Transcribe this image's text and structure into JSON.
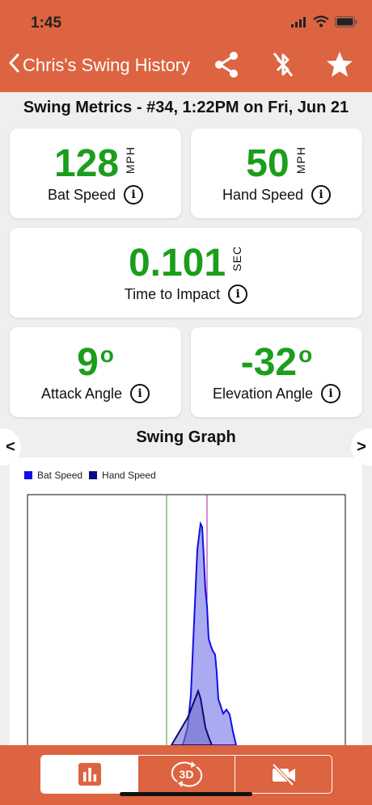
{
  "status": {
    "time": "1:45"
  },
  "nav": {
    "back_label": "Chris's Swing History"
  },
  "metrics_title": "Swing Metrics - #34, 1:22PM on Fri, Jun 21",
  "metrics": {
    "bat_speed": {
      "value": "128",
      "unit": "MPH",
      "label": "Bat Speed"
    },
    "hand_speed": {
      "value": "50",
      "unit": "MPH",
      "label": "Hand Speed"
    },
    "time_to_impact": {
      "value": "0.101",
      "unit": "SEC",
      "label": "Time to Impact"
    },
    "attack_angle": {
      "value": "9",
      "unit": "o",
      "label": "Attack Angle"
    },
    "elevation_angle": {
      "value": "-32",
      "unit": "o",
      "label": "Elevation Angle"
    }
  },
  "graph": {
    "title": "Swing Graph",
    "prev_label": "<",
    "next_label": ">",
    "bottom_tab_3d_label": "3D"
  },
  "chart_data": {
    "type": "area",
    "series": [
      {
        "name": "Bat Speed",
        "color": "#1010e6"
      },
      {
        "name": "Hand Speed",
        "color": "#0a0a7a"
      }
    ]
  },
  "colors": {
    "accent": "#dc6440",
    "value_green": "#1b9e1b"
  }
}
